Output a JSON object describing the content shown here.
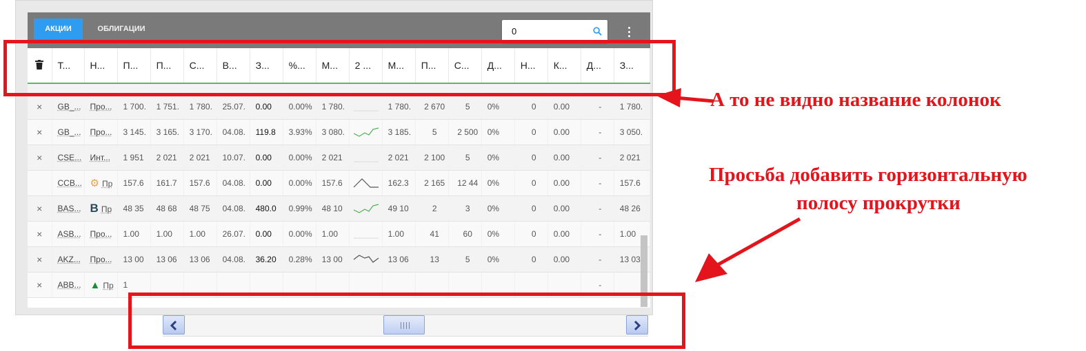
{
  "tabs": [
    {
      "label": "АКЦИИ",
      "active": true
    },
    {
      "label": "ОБЛИГАЦИИ",
      "active": false
    }
  ],
  "search": {
    "value": "0"
  },
  "columns": [
    "",
    "Т...",
    "Н...",
    "П...",
    "П...",
    "С...",
    "В...",
    "З...",
    "%...",
    "М...",
    "2 ...",
    "М...",
    "П...",
    "С...",
    "Д...",
    "Н...",
    "К...",
    "Д...",
    "З..."
  ],
  "rows": [
    {
      "x": "×",
      "c1": "GB_...",
      "c2": "Про...",
      "c3": "1 700.",
      "c4": "1 751.",
      "c5": "1 780.",
      "c6": "25.07.",
      "c7": "0.00",
      "c8": "0.00%",
      "c9": "1 780.",
      "spark": "flat",
      "c11": "1 780.",
      "c12": "2 670",
      "c13": "5",
      "c14": "0%",
      "c15": "0",
      "c16": "0.00",
      "c17": "-",
      "c18": "1 780."
    },
    {
      "x": "×",
      "c1": "GB_...",
      "c2": "Про...",
      "c3": "3 145.",
      "c4": "3 165.",
      "c5": "3 170.",
      "c6": "04.08.",
      "c7": "119.8",
      "c8": "3.93%",
      "c9": "3 080.",
      "spark": "up",
      "c11": "3 185.",
      "c12": "5",
      "c13": "2 500",
      "c14": "0%",
      "c15": "0",
      "c16": "0.00",
      "c17": "-",
      "c18": "3 050."
    },
    {
      "x": "×",
      "c1": "CSE...",
      "c2": "Инт...",
      "c3": "1 951",
      "c4": "2 021",
      "c5": "2 021",
      "c6": "10.07.",
      "c7": "0.00",
      "c8": "0.00%",
      "c9": "2 021",
      "spark": "flat",
      "c11": "2 021",
      "c12": "2 100",
      "c13": "5",
      "c14": "0%",
      "c15": "0",
      "c16": "0.00",
      "c17": "-",
      "c18": "2 021"
    },
    {
      "x": "",
      "c1": "CCB...",
      "c2": "Пр",
      "c3": "157.6",
      "c4": "161.7",
      "c5": "157.6",
      "c6": "04.08.",
      "c7": "0.00",
      "c8": "0.00%",
      "c9": "157.6",
      "spark": "peak",
      "c11": "162.3",
      "c12": "2 165",
      "c13": "12 44",
      "c14": "0%",
      "c15": "0",
      "c16": "0.00",
      "c17": "-",
      "c18": "157.6"
    },
    {
      "x": "×",
      "c1": "BAS...",
      "c2": "Пр",
      "c3": "48 35",
      "c4": "48 68",
      "c5": "48 75",
      "c6": "04.08.",
      "c7": "480.0",
      "c8": "0.99%",
      "c9": "48 10",
      "spark": "up",
      "c11": "49 10",
      "c12": "2",
      "c13": "3",
      "c14": "0%",
      "c15": "0",
      "c16": "0.00",
      "c17": "-",
      "c18": "48 26"
    },
    {
      "x": "×",
      "c1": "ASB...",
      "c2": "Про...",
      "c3": "1.00",
      "c4": "1.00",
      "c5": "1.00",
      "c6": "26.07.",
      "c7": "0.00",
      "c8": "0.00%",
      "c9": "1.00",
      "spark": "flat",
      "c11": "1.00",
      "c12": "41",
      "c13": "60",
      "c14": "0%",
      "c15": "0",
      "c16": "0.00",
      "c17": "-",
      "c18": "1.00"
    },
    {
      "x": "×",
      "c1": "AKZ...",
      "c2": "Про...",
      "c3": "13 00",
      "c4": "13 06",
      "c5": "13 06",
      "c6": "04.08.",
      "c7": "36.20",
      "c8": "0.28%",
      "c9": "13 00",
      "spark": "peak2",
      "c11": "13 06",
      "c12": "13",
      "c13": "5",
      "c14": "0%",
      "c15": "0",
      "c16": "0.00",
      "c17": "-",
      "c18": "13 03"
    },
    {
      "x": "×",
      "c1": "ABB...",
      "c2": "Пр",
      "c3": "1",
      "c4": "",
      "c5": "",
      "c6": "",
      "c7": "",
      "c8": "",
      "c9": "",
      "spark": "",
      "c11": "",
      "c12": "",
      "c13": "",
      "c14": "",
      "c15": "",
      "c16": "",
      "c17": "-",
      "c18": ""
    }
  ],
  "annotations": {
    "note1": "А то не видно название колонок",
    "note2_line1": "Просьба добавить горизонтальную",
    "note2_line2": "полосу прокрутки"
  },
  "colors": {
    "accent_tab": "#2e9cf0",
    "annotation_red": "#e3141b",
    "header_underline": "#5cb85c"
  }
}
